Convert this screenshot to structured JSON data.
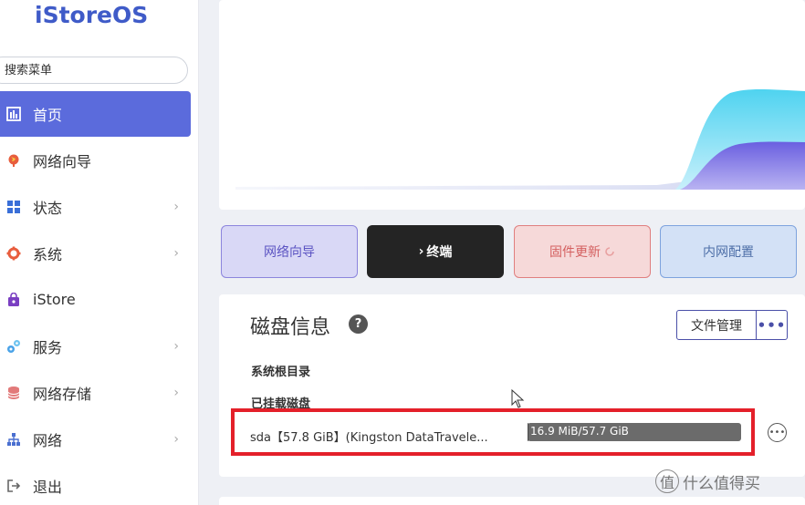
{
  "brand": {
    "logo_text": "iStoreOS"
  },
  "search": {
    "placeholder": "搜索菜单"
  },
  "nav": {
    "items": [
      {
        "label": "首页",
        "icon": "dashboard-icon",
        "active": true,
        "has_submenu": false
      },
      {
        "label": "网络向导",
        "icon": "globe-icon",
        "active": false,
        "has_submenu": false
      },
      {
        "label": "状态",
        "icon": "grid-icon",
        "active": false,
        "has_submenu": true
      },
      {
        "label": "系统",
        "icon": "gear-icon",
        "active": false,
        "has_submenu": true
      },
      {
        "label": "iStore",
        "icon": "store-bag-icon",
        "active": false,
        "has_submenu": false
      },
      {
        "label": "服务",
        "icon": "services-icon",
        "active": false,
        "has_submenu": true
      },
      {
        "label": "网络存储",
        "icon": "database-icon",
        "active": false,
        "has_submenu": true
      },
      {
        "label": "网络",
        "icon": "network-icon",
        "active": false,
        "has_submenu": true
      },
      {
        "label": "退出",
        "icon": "logout-icon",
        "active": false,
        "has_submenu": false
      }
    ],
    "chevron": "›"
  },
  "quick_actions": {
    "wizard": "网络向导",
    "terminal": "终端",
    "terminal_prefix": "›",
    "firmware": "固件更新",
    "lan_config": "内网配置"
  },
  "disk": {
    "title": "磁盘信息",
    "help": "?",
    "file_manager": "文件管理",
    "more": "•••",
    "root_label": "系统根目录",
    "mounted_label": "已挂载磁盘",
    "mounted": [
      {
        "name": "sda【57.8 GiB】(Kingston DataTravele...",
        "usage_text": "16.9 MiB/57.7 GiB",
        "usage_fraction": 0.0003
      }
    ],
    "row_more": "•••"
  },
  "watermark": {
    "badge": "值",
    "text": "什么值得买"
  },
  "colors": {
    "accent": "#5b6bdc",
    "logo": "#3f5bc8",
    "highlight": "#e4202a",
    "chart_cyan": "#5ad6f2",
    "chart_purple": "#6f63e0"
  }
}
